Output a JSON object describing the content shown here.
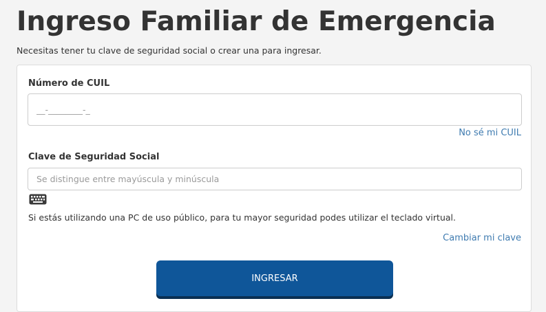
{
  "header": {
    "title": "Ingreso Familiar de Emergencia",
    "subtitle": "Necesitas tener tu clave de seguridad social o crear una para ingresar."
  },
  "form": {
    "cuil": {
      "label": "Número de CUIL",
      "placeholder": "__-________-_",
      "value": "",
      "help_link": "No sé mi CUIL"
    },
    "password": {
      "label": "Clave de Seguridad Social",
      "placeholder": "Se distingue entre mayúscula y minúscula",
      "value": "",
      "keyboard_icon": "keyboard-icon",
      "help_text": "Si estás utilizando una PC de uso público, para tu mayor seguridad podes utilizar el teclado virtual.",
      "change_link": "Cambiar mi clave"
    },
    "submit_label": "INGRESAR"
  },
  "colors": {
    "background": "#f4f4f4",
    "text": "#333333",
    "link": "#3f7bb0",
    "button": "#0f5699",
    "button_shadow": "#0a2f52"
  }
}
